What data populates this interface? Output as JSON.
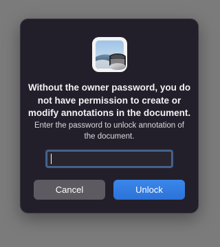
{
  "dialog": {
    "heading": "Without the owner password, you do not have permission to create or modify annotations in the document.",
    "message": "Enter the password to unlock annotation of the document.",
    "password_field": {
      "value": "",
      "placeholder": ""
    },
    "buttons": {
      "cancel_label": "Cancel",
      "unlock_label": "Unlock"
    },
    "app_icon": "preview-app-icon"
  },
  "colors": {
    "background": "#7b7b7b",
    "dialog": "#231f2a",
    "cancel_button": "#5d5a62",
    "unlock_button": "#2c72d9",
    "focus_ring": "#3f5f8a"
  }
}
